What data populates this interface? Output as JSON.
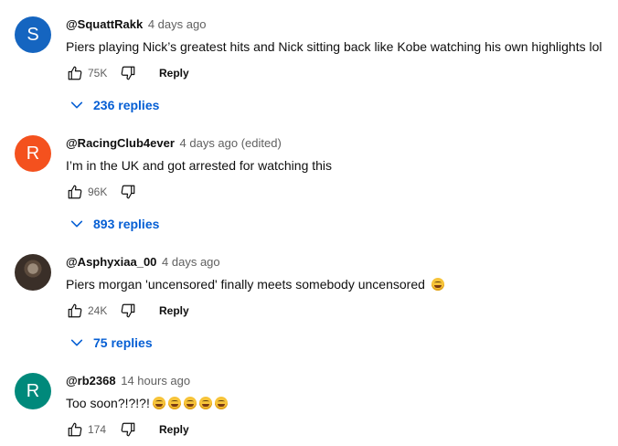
{
  "comments": [
    {
      "avatar_letter": "S",
      "avatar_color": "#1565c0",
      "author": "@SquattRakk",
      "time": "4 days ago",
      "text": "Piers playing Nick’s greatest hits and Nick sitting back like Kobe watching his own highlights lol",
      "likes": "75K",
      "reply_label": "Reply",
      "replies_label": "236 replies"
    },
    {
      "avatar_letter": "R",
      "avatar_color": "#f4511e",
      "author": "@RacingClub4ever",
      "time": "4 days ago (edited)",
      "text": "I’m in the UK and got arrested for watching this",
      "likes": "96K",
      "replies_label": "893 replies"
    },
    {
      "avatar_letter": "",
      "author": "@Asphyxiaa_00",
      "time": "4 days ago",
      "text": "Piers morgan 'uncensored' finally meets somebody uncensored",
      "likes": "24K",
      "reply_label": "Reply",
      "replies_label": "75 replies"
    },
    {
      "avatar_letter": "R",
      "avatar_color": "#00897b",
      "author": "@rb2368",
      "time": "14 hours ago",
      "text": "Too soon?!?!?!",
      "likes": "174",
      "reply_label": "Reply"
    }
  ]
}
